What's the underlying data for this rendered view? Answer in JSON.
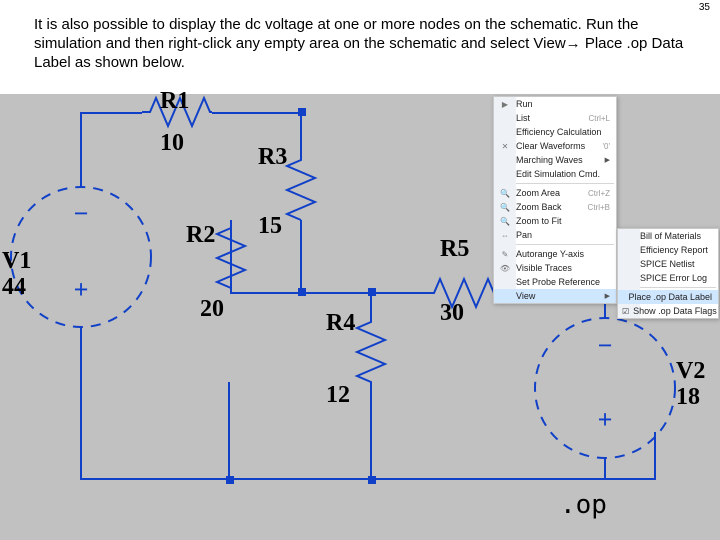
{
  "page_number": "35",
  "body_text": "It is also possible to display the dc voltage at one or more nodes on the schematic. Run the simulation and then right-click any empty area on the schematic and select View",
  "body_text_tail": " Place .op Data Label as shown below.",
  "arrow": "→",
  "components": {
    "R1": {
      "name": "R1",
      "value": "10"
    },
    "R2": {
      "name": "R2",
      "value": "20"
    },
    "R3": {
      "name": "R3",
      "value": "15"
    },
    "R4": {
      "name": "R4",
      "value": "12"
    },
    "R5": {
      "name": "R5",
      "value": "30"
    },
    "V1": {
      "name": "V1",
      "value": "44"
    },
    "V2": {
      "name": "V2",
      "value": "18"
    }
  },
  "directive": ".op",
  "menu": {
    "items": [
      {
        "icon": "▶",
        "label": "Run",
        "shortcut": ""
      },
      {
        "icon": "",
        "label": "List",
        "shortcut": "Ctrl+L"
      },
      {
        "icon": "",
        "label": "Efficiency Calculation",
        "shortcut": ""
      },
      {
        "icon": "✕",
        "label": "Clear Waveforms",
        "shortcut": "'0'"
      },
      {
        "icon": "",
        "label": "Marching Waves",
        "shortcut": "",
        "arrow": true
      },
      {
        "icon": "",
        "label": "Edit Simulation Cmd.",
        "shortcut": ""
      }
    ],
    "zoom": [
      {
        "icon": "🔍",
        "label": "Zoom Area",
        "shortcut": "Ctrl+Z"
      },
      {
        "icon": "🔍",
        "label": "Zoom Back",
        "shortcut": "Ctrl+B"
      },
      {
        "icon": "🔍",
        "label": "Zoom to Fit",
        "shortcut": ""
      },
      {
        "icon": "⇔",
        "label": "Pan",
        "shortcut": ""
      }
    ],
    "other": [
      {
        "icon": "✎",
        "label": "Autorange Y-axis",
        "shortcut": ""
      },
      {
        "icon": "👁",
        "label": "Visible Traces",
        "shortcut": ""
      },
      {
        "icon": "",
        "label": "Set Probe Reference",
        "shortcut": ""
      },
      {
        "icon": "",
        "label": "View",
        "shortcut": "",
        "arrow": true,
        "hover": true
      }
    ]
  },
  "submenu": {
    "items": [
      {
        "label": "Bill of Materials"
      },
      {
        "label": "Efficiency Report"
      },
      {
        "label": "SPICE Netlist"
      },
      {
        "label": "SPICE Error Log"
      }
    ],
    "items2": [
      {
        "label": "Place .op Data Label",
        "selected": true
      },
      {
        "label": "Show .op Data Flags",
        "check": true
      }
    ]
  }
}
